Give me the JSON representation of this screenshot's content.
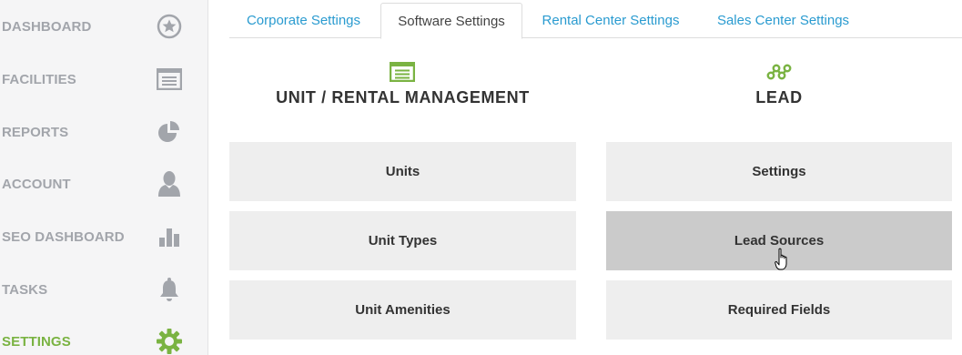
{
  "sidebar": {
    "items": [
      {
        "label": "DASHBOARD",
        "icon": "star-circle-icon"
      },
      {
        "label": "FACILITIES",
        "icon": "storage-unit-icon"
      },
      {
        "label": "REPORTS",
        "icon": "pie-chart-icon"
      },
      {
        "label": "ACCOUNT",
        "icon": "user-icon"
      },
      {
        "label": "SEO DASHBOARD",
        "icon": "bar-chart-icon"
      },
      {
        "label": "TASKS",
        "icon": "bell-icon"
      },
      {
        "label": "SETTINGS",
        "icon": "gear-icon",
        "active": true
      }
    ]
  },
  "tabs": [
    {
      "label": "Corporate Settings"
    },
    {
      "label": "Software Settings",
      "active": true
    },
    {
      "label": "Rental Center Settings"
    },
    {
      "label": "Sales Center Settings"
    }
  ],
  "sections": {
    "unit_rental": {
      "title": "UNIT / RENTAL MANAGEMENT",
      "icon": "storage-unit-icon",
      "tiles": [
        "Units",
        "Unit Types",
        "Unit Amenities"
      ]
    },
    "lead": {
      "title": "LEAD",
      "icon": "lead-nodes-icon",
      "tiles": [
        "Settings",
        "Lead Sources",
        "Required Fields"
      ]
    }
  },
  "colors": {
    "accent_green": "#7ab342",
    "link_blue": "#2a9bd0",
    "sidebar_text": "#a2a5ab",
    "tile_bg": "#eeeeee",
    "tile_hover_bg": "#cbcbcb"
  }
}
